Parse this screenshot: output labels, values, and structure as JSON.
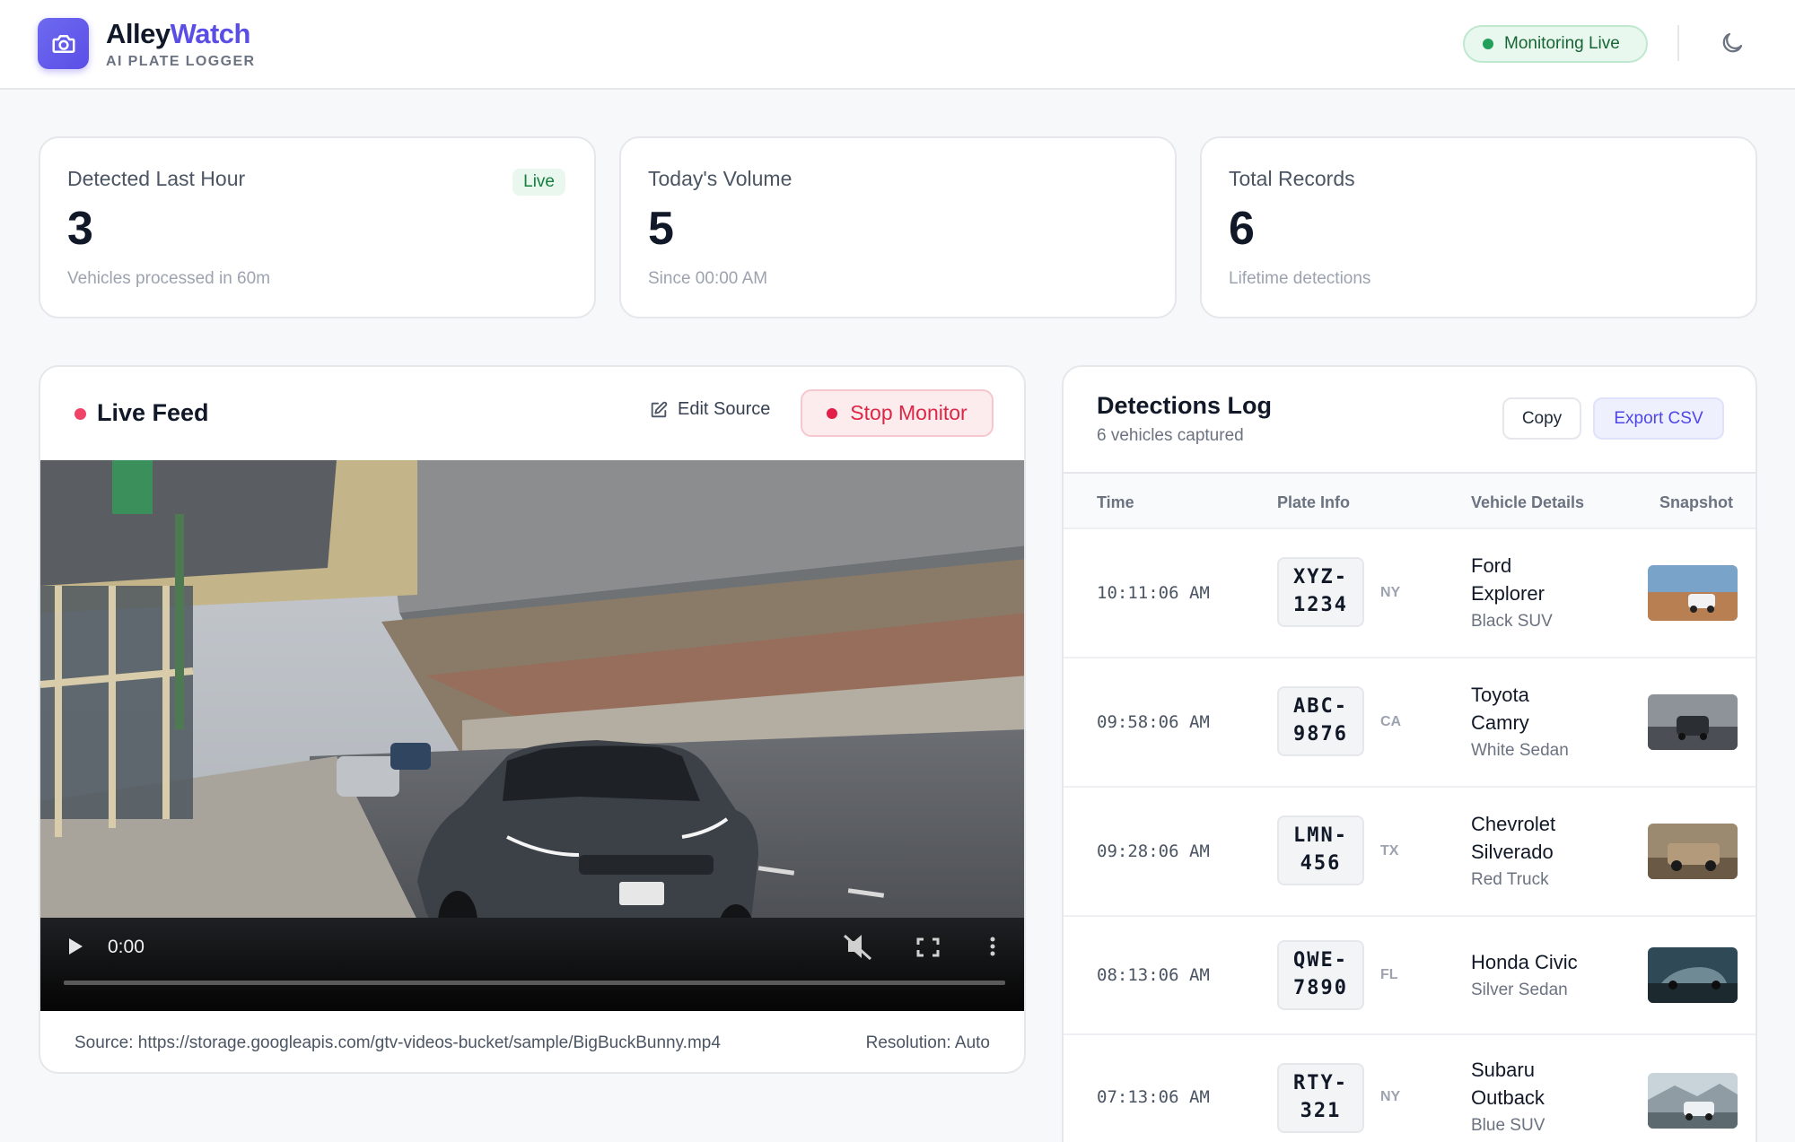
{
  "app": {
    "brand_part1": "Alley",
    "brand_part2": "Watch",
    "subtitle": "AI PLATE LOGGER",
    "status_label": "Monitoring Live"
  },
  "stats": [
    {
      "title": "Detected Last Hour",
      "value": "3",
      "sub": "Vehicles processed in 60m",
      "badge": "Live"
    },
    {
      "title": "Today's Volume",
      "value": "5",
      "sub": "Since 00:00 AM"
    },
    {
      "title": "Total Records",
      "value": "6",
      "sub": "Lifetime detections"
    }
  ],
  "feed": {
    "title": "Live Feed",
    "edit_label": "Edit Source",
    "stop_label": "Stop Monitor",
    "time": "0:00",
    "progress": 0,
    "source": "Source: https://storage.googleapis.com/gtv-videos-bucket/sample/BigBuckBunny.mp4",
    "resolution": "Resolution: Auto"
  },
  "log": {
    "title": "Detections Log",
    "subtitle": "6 vehicles captured",
    "copy_label": "Copy",
    "export_label": "Export CSV",
    "columns": [
      "Time",
      "Plate Info",
      "Vehicle Details",
      "Snapshot"
    ],
    "rows": [
      {
        "time": "10:11:06 AM",
        "plate_l1": "XYZ-",
        "plate_l2": "1234",
        "state": "NY",
        "make": "Ford",
        "model": "Explorer",
        "desc": "Black SUV"
      },
      {
        "time": "09:58:06 AM",
        "plate_l1": "ABC-",
        "plate_l2": "9876",
        "state": "CA",
        "make": "Toyota",
        "model": "Camry",
        "desc": "White Sedan"
      },
      {
        "time": "09:28:06 AM",
        "plate_l1": "LMN-",
        "plate_l2": "456",
        "state": "TX",
        "make": "Chevrolet",
        "model": "Silverado",
        "desc": "Red Truck"
      },
      {
        "time": "08:13:06 AM",
        "plate_l1": "QWE-",
        "plate_l2": "7890",
        "state": "FL",
        "make": "Honda Civic",
        "model": "",
        "desc": "Silver Sedan"
      },
      {
        "time": "07:13:06 AM",
        "plate_l1": "RTY-",
        "plate_l2": "321",
        "state": "NY",
        "make": "Subaru",
        "model": "Outback",
        "desc": "Blue SUV"
      }
    ]
  },
  "colors": {
    "brand": "#5b4ee6",
    "live": "#22a05a",
    "danger": "#e11d48"
  }
}
